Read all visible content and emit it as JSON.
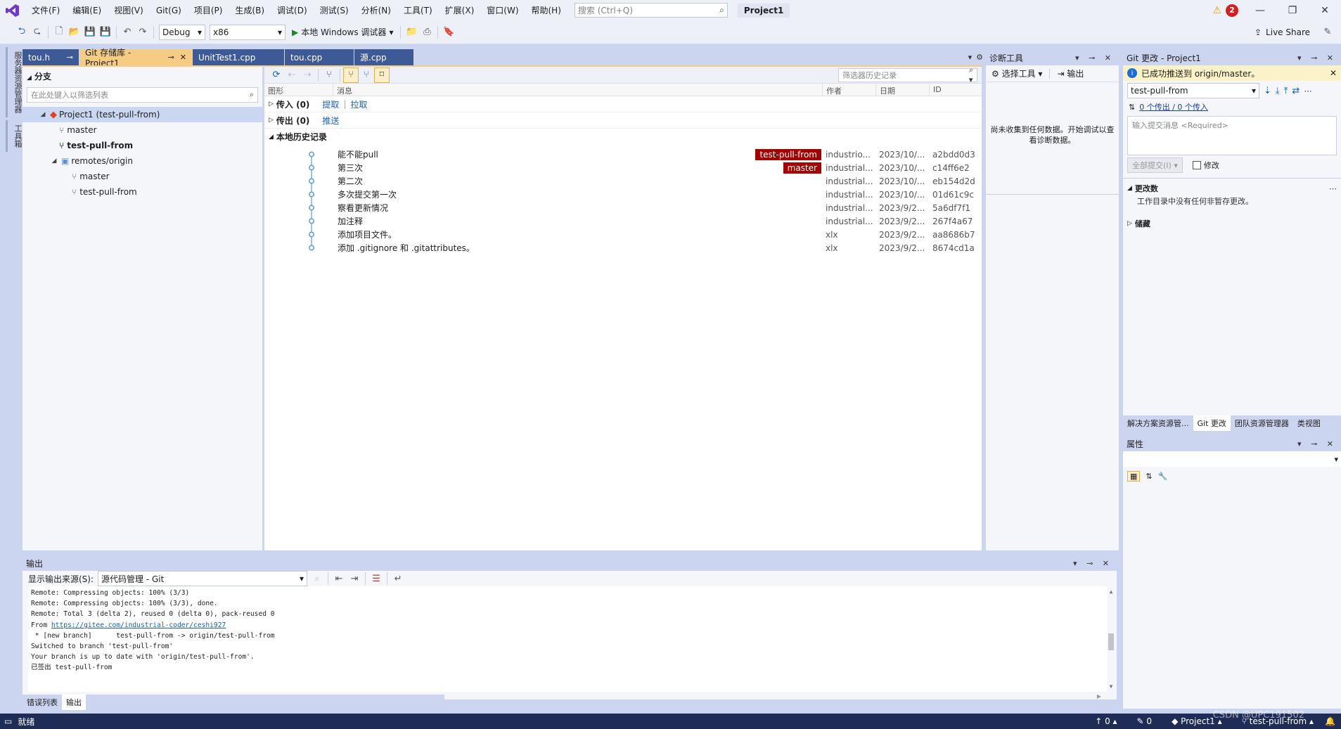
{
  "menu": [
    "文件(F)",
    "编辑(E)",
    "视图(V)",
    "Git(G)",
    "项目(P)",
    "生成(B)",
    "调试(D)",
    "测试(S)",
    "分析(N)",
    "工具(T)",
    "扩展(X)",
    "窗口(W)",
    "帮助(H)"
  ],
  "search": {
    "placeholder": "搜索 (Ctrl+Q)"
  },
  "project_title": "Project1",
  "notification_count": "2",
  "toolbar": {
    "config": "Debug",
    "platform": "x86",
    "debug_label": "本地 Windows 调试器",
    "live_share": "Live Share"
  },
  "left_vertical_tabs": [
    "服务器资源管理器",
    "工具箱"
  ],
  "doc_tabs": [
    {
      "label": "tou.h",
      "active": false
    },
    {
      "label": "Git 存储库 - Project1",
      "active": true
    },
    {
      "label": "UnitTest1.cpp",
      "active": false
    },
    {
      "label": "tou.cpp",
      "active": false
    },
    {
      "label": "源.cpp",
      "active": false
    }
  ],
  "branches": {
    "title": "分支",
    "filter_placeholder": "在此处键入以筛选列表",
    "repo": "Project1 (test-pull-from)",
    "local": [
      "master",
      "test-pull-from"
    ],
    "remote_group": "remotes/origin",
    "remote": [
      "master",
      "test-pull-from"
    ]
  },
  "history": {
    "filter_placeholder": "筛选器历史记录",
    "columns": [
      "图形",
      "消息",
      "作者",
      "日期",
      "ID"
    ],
    "incoming": "传入 (0)",
    "incoming_links": [
      "提取",
      "拉取"
    ],
    "outgoing": "传出 (0)",
    "outgoing_link": "推送",
    "local_group": "本地历史记录",
    "commits": [
      {
        "msg": "能不能pull",
        "tag": "test-pull-from",
        "author": "industrio...",
        "date": "2023/10/...",
        "id": "a2bdd0d3"
      },
      {
        "msg": "第三次",
        "tag": "master",
        "author": "industrial...",
        "date": "2023/10/...",
        "id": "c14ff6e2"
      },
      {
        "msg": "第二次",
        "tag": "",
        "author": "industrial...",
        "date": "2023/10/...",
        "id": "eb154d2d"
      },
      {
        "msg": "多次提交第一次",
        "tag": "",
        "author": "industrial...",
        "date": "2023/10/...",
        "id": "01d61c9c"
      },
      {
        "msg": "察看更新情况",
        "tag": "",
        "author": "industrial...",
        "date": "2023/9/2...",
        "id": "5a6df7f1"
      },
      {
        "msg": "加注释",
        "tag": "",
        "author": "industrial...",
        "date": "2023/9/2...",
        "id": "267f4a67"
      },
      {
        "msg": "添加项目文件。",
        "tag": "",
        "author": "xlx",
        "date": "2023/9/2...",
        "id": "aa8686b7"
      },
      {
        "msg": "添加 .gitignore 和 .gitattributes。",
        "tag": "",
        "author": "xlx",
        "date": "2023/9/2...",
        "id": "8674cd1a"
      }
    ]
  },
  "diag": {
    "title": "诊断工具",
    "select_tools": "选择工具",
    "output": "输出",
    "empty_msg": "尚未收集到任何数据。开始调试以查看诊断数据。"
  },
  "git_changes": {
    "title": "Git 更改 - Project1",
    "info": "已成功推送到 origin/master。",
    "branch": "test-pull-from",
    "sync": "0 个传出 / 0 个传入",
    "commit_placeholder": "输入提交消息 <Required>",
    "commit_all": "全部提交(I)",
    "amend": "修改",
    "changes_title": "更改数",
    "changes_msg": "工作目录中没有任何非暂存更改。",
    "stash": "储藏"
  },
  "right_tabs": [
    "解决方案资源管...",
    "Git 更改",
    "团队资源管理器",
    "类视图"
  ],
  "properties": {
    "title": "属性"
  },
  "output": {
    "title": "输出",
    "source_label": "显示输出来源(S):",
    "source": "源代码管理 - Git",
    "lines": [
      "Remote: Compressing objects: 100% (3/3)",
      "Remote: Compressing objects: 100% (3/3), done.",
      "Remote: Total 3 (delta 2), reused 0 (delta 0), pack-reused 0",
      "From ",
      " * [new branch]      test-pull-from -> origin/test-pull-from",
      "Switched to branch 'test-pull-from'",
      "Your branch is up to date with 'origin/test-pull-from'.",
      "已签出 test-pull-from"
    ],
    "url": "https://gitee.com/industrial-coder/ceshi927"
  },
  "bottom_tabs": [
    "错误列表",
    "输出"
  ],
  "status": {
    "ready": "就绪",
    "up": "0",
    "edits": "0",
    "project": "Project1",
    "branch": "test-pull-from",
    "watermark": "CSDN @UPC191502"
  }
}
